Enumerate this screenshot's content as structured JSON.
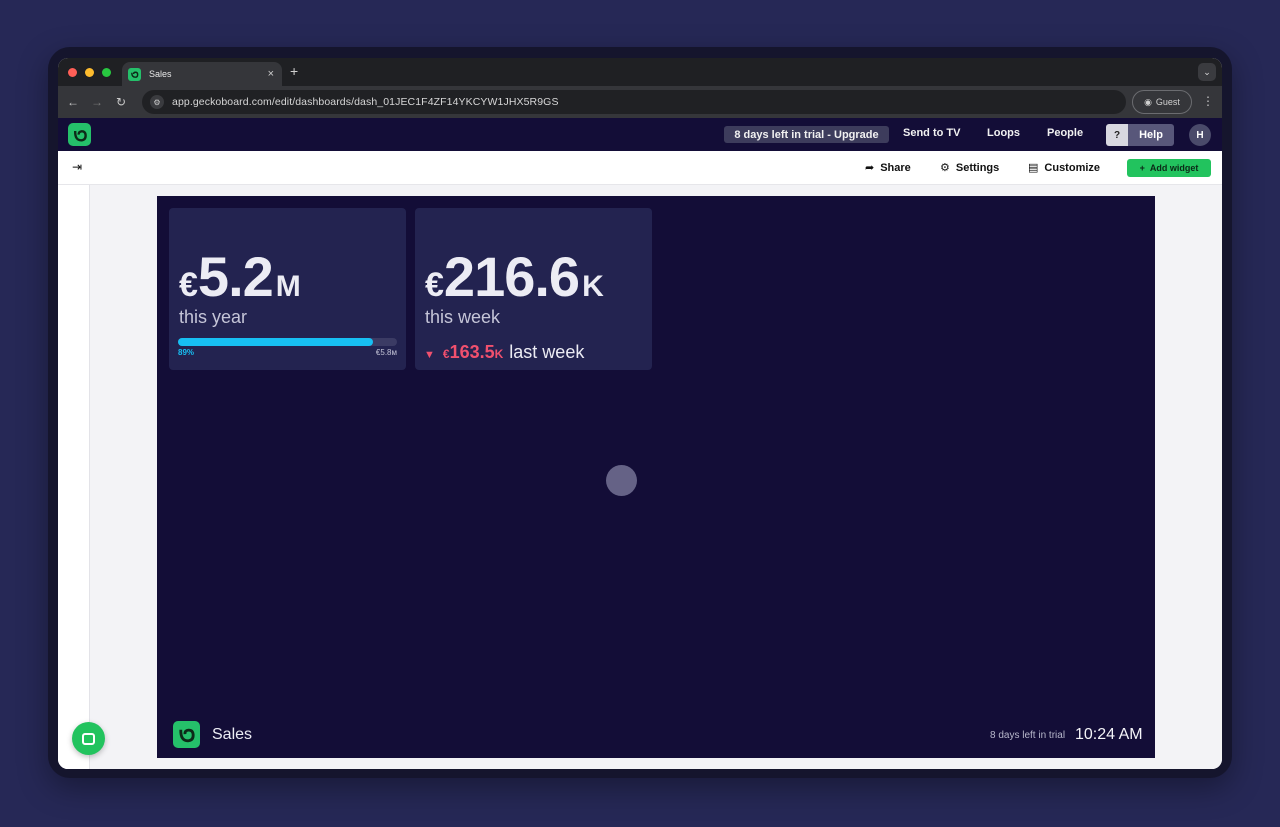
{
  "browser": {
    "tab_title": "Sales",
    "tab_close": "×",
    "new_tab": "+",
    "url": "app.geckoboard.com/edit/dashboards/dash_01JEC1F4ZF14YKCYW1JHX5R9GS",
    "profile_label": "Guest",
    "traffic_lights": [
      "#ff5f57",
      "#febc2e",
      "#28c840"
    ]
  },
  "app_header": {
    "trial_banner": "8 days left in trial - Upgrade",
    "nav": [
      "Send to TV",
      "Loops",
      "People"
    ],
    "help_q": "?",
    "help_label": "Help",
    "avatar_initial": "H"
  },
  "toolbar": {
    "share_label": "Share",
    "settings_label": "Settings",
    "customize_label": "Customize",
    "add_widget_label": "Add widget"
  },
  "dashboard": {
    "widgets": [
      {
        "currency": "€",
        "value": "5.2",
        "suffix": "M",
        "label": "this year",
        "progress_percent": 89,
        "progress_label": "89%",
        "goal_label": "€5.8м"
      },
      {
        "currency": "€",
        "value": "216.6",
        "suffix": "K",
        "label": "this week",
        "comparison_currency": "€",
        "comparison_value": "163.5",
        "comparison_suffix": "K",
        "comparison_label": "last week",
        "trend": "down"
      }
    ],
    "footer": {
      "title": "Sales",
      "trial_text": "8 days left in trial",
      "time": "10:24 AM"
    }
  },
  "colors": {
    "brand_green": "#25c06a",
    "dashboard_bg": "#130d37",
    "widget_bg": "#232350",
    "progress": "#17bff3",
    "negative": "#f0506e"
  }
}
